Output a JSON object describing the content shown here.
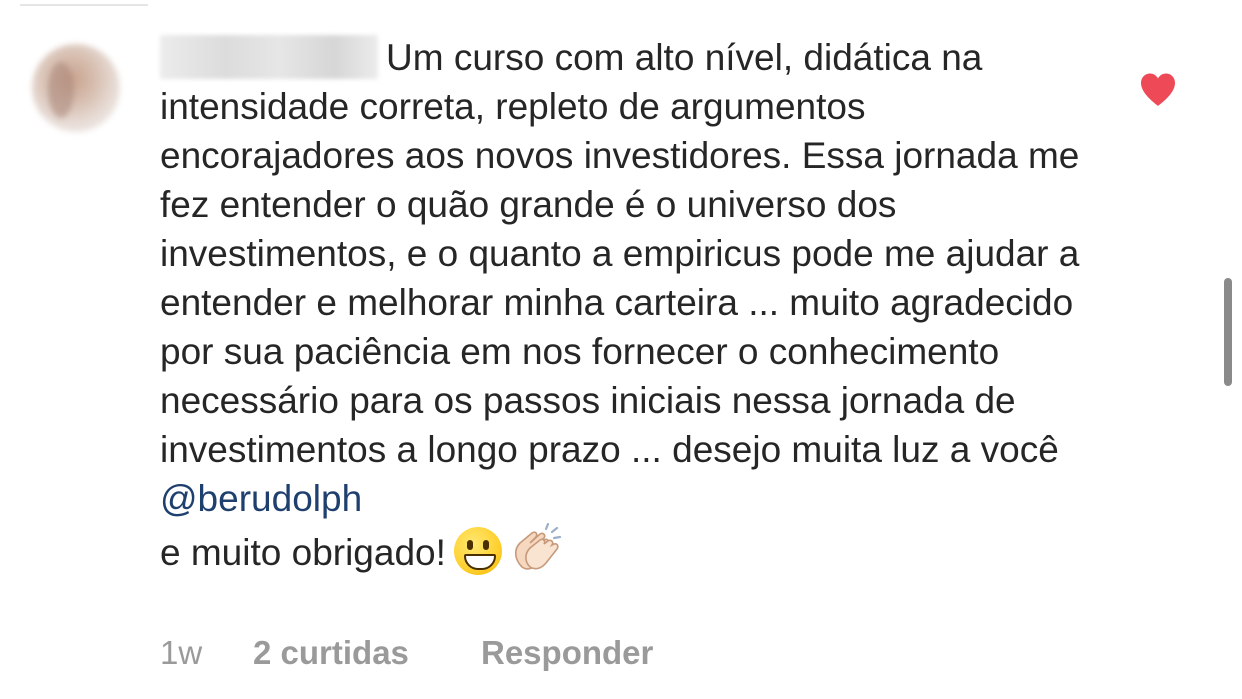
{
  "comment": {
    "username": "juliacutarim",
    "text": "Um curso com alto nível, didática na intensidade correta, repleto de argumentos encorajadores aos novos investidores. Essa jornada me fez entender o quão grande é o universo dos investimentos, e o quanto a empiricus pode me ajudar a entender e melhorar minha carteira ... muito agradecido por sua paciência em nos fornecer o conhecimento necessário para os passos iniciais nessa jornada de investimentos a longo prazo ... desejo muita luz a você ",
    "mention": "@berudolph",
    "closing": "e muito obrigado!",
    "emojis": [
      "grinning-face",
      "clapping-hands"
    ],
    "liked": true
  },
  "meta": {
    "time": "1w",
    "likes": "2 curtidas",
    "reply": "Responder"
  },
  "colors": {
    "heart": "#ed4956",
    "text": "#262626",
    "mention": "#1f3f6e",
    "meta": "#9a9a9a"
  }
}
